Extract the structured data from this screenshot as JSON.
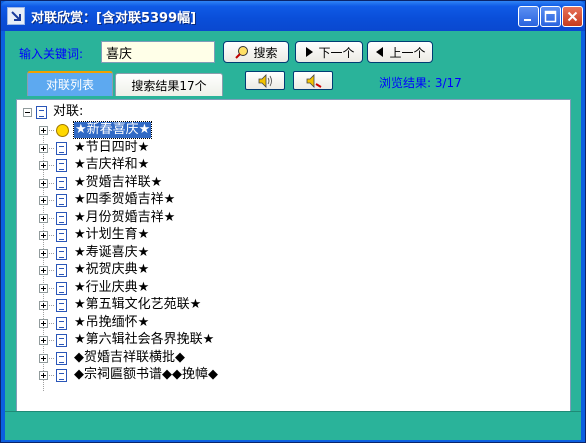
{
  "window": {
    "title": "对联欣赏：[含对联5399幅]"
  },
  "search": {
    "label": "输入关键词:",
    "value": "喜庆",
    "search_button": "搜索",
    "next_button": "下一个",
    "prev_button": "上一个"
  },
  "tabs": [
    {
      "label": "对联列表",
      "active": true
    },
    {
      "label": "搜索结果17个",
      "active": false
    }
  ],
  "browse_status": "浏览结果: 3/17",
  "tree": {
    "root": "对联:",
    "items": [
      {
        "label": "★新春喜庆★",
        "selected": true,
        "icon": "smiley-icon"
      },
      {
        "label": "★节日四时★",
        "selected": false,
        "icon": "document-icon"
      },
      {
        "label": "★吉庆祥和★",
        "selected": false,
        "icon": "document-icon"
      },
      {
        "label": "★贺婚吉祥联★",
        "selected": false,
        "icon": "document-icon"
      },
      {
        "label": "★四季贺婚吉祥★",
        "selected": false,
        "icon": "document-icon"
      },
      {
        "label": "★月份贺婚吉祥★",
        "selected": false,
        "icon": "document-icon"
      },
      {
        "label": "★计划生育★",
        "selected": false,
        "icon": "document-icon"
      },
      {
        "label": "★寿诞喜庆★",
        "selected": false,
        "icon": "document-icon"
      },
      {
        "label": "★祝贺庆典★",
        "selected": false,
        "icon": "document-icon"
      },
      {
        "label": "★行业庆典★",
        "selected": false,
        "icon": "document-icon"
      },
      {
        "label": "★第五辑文化艺苑联★",
        "selected": false,
        "icon": "document-icon"
      },
      {
        "label": "★吊挽缅怀★",
        "selected": false,
        "icon": "document-icon"
      },
      {
        "label": "★第六辑社会各界挽联★",
        "selected": false,
        "icon": "document-icon"
      },
      {
        "label": "◆贺婚吉祥联横批◆",
        "selected": false,
        "icon": "document-icon"
      },
      {
        "label": "◆宗祠匾额书谱◆◆挽幛◆",
        "selected": false,
        "icon": "document-icon"
      }
    ]
  },
  "colors": {
    "titlebar": "#0a4ed8",
    "client_bg": "#2ab39a",
    "label_blue": "#0000ff",
    "selection": "#316ac5"
  }
}
